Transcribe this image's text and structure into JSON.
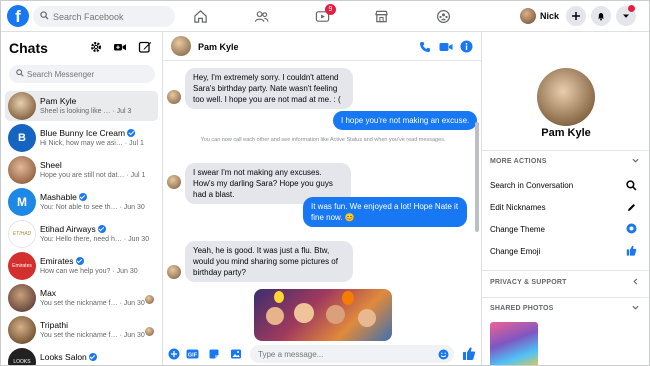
{
  "topbar": {
    "logo_letter": "f",
    "search_placeholder": "Search Facebook",
    "watch_badge": "9",
    "user_name": "Nick"
  },
  "chats": {
    "title": "Chats",
    "search_placeholder": "Search Messenger",
    "items": [
      {
        "name": "Pam Kyle",
        "preview": "Sheel is looking like … · Jul 3",
        "verified": false,
        "avatar_color": "#8a6a48"
      },
      {
        "name": "Blue Bunny Ice Cream",
        "preview": "Hi Nick, how may we asi… · Jul 1",
        "verified": true,
        "avatar_color": "#1565c0"
      },
      {
        "name": "Sheel",
        "preview": "Hope you are still not dat… · Jul 1",
        "verified": false,
        "avatar_color": "#b07a5a"
      },
      {
        "name": "Mashable",
        "preview": "You: Not able to see th… · Jun 30",
        "verified": true,
        "avatar_color": "#1e88e5"
      },
      {
        "name": "Etihad Airways",
        "preview": "You: Hello there, need h… · Jun 30",
        "verified": true,
        "avatar_color": "#c7a86a"
      },
      {
        "name": "Emirates",
        "preview": "How can we help you? · Jun 30",
        "verified": true,
        "avatar_color": "#d32f2f"
      },
      {
        "name": "Max",
        "preview": "You set the nickname f… · Jun 30",
        "verified": false,
        "avatar_color": "#6d4c41"
      },
      {
        "name": "Tripathi",
        "preview": "You set the nickname f… · Jun 30",
        "verified": false,
        "avatar_color": "#7a5a3a"
      },
      {
        "name": "Looks Salon",
        "preview": "",
        "verified": true,
        "avatar_color": "#212121"
      }
    ]
  },
  "conversation": {
    "contact_name": "Pam Kyle",
    "messages": [
      {
        "dir": "in",
        "text": "Hey, I'm extremely sorry. I couldn't attend Sara's birthday party. Nate wasn't feeling too well. I hope you are not mad at me. : ("
      },
      {
        "dir": "out",
        "text": "I hope you're not making an excuse."
      },
      {
        "dir": "system",
        "text": "You can now call each other and see information like Active Status and when you've read messages."
      },
      {
        "dir": "in",
        "text": "I swear I'm not making any excuses. How's my darling Sara? Hope you guys had a blast."
      },
      {
        "dir": "out",
        "text": "It was fun. We enjoyed a lot! Hope Nate it fine now. 😊"
      },
      {
        "dir": "in",
        "text": "Yeah, he is good. It was just a flu. Btw, would you mind sharing some pictures of birthday party?"
      }
    ],
    "composer_placeholder": "Type a message..."
  },
  "info_panel": {
    "name": "Pam Kyle",
    "more_actions_label": "MORE ACTIONS",
    "actions": [
      "Search in Conversation",
      "Edit Nicknames",
      "Change Theme",
      "Change Emoji"
    ],
    "privacy_label": "PRIVACY & SUPPORT",
    "shared_photos_label": "SHARED PHOTOS"
  },
  "colors": {
    "accent": "#1877f2",
    "bubble_in": "#e4e6eb",
    "badge": "#e41e3f"
  }
}
